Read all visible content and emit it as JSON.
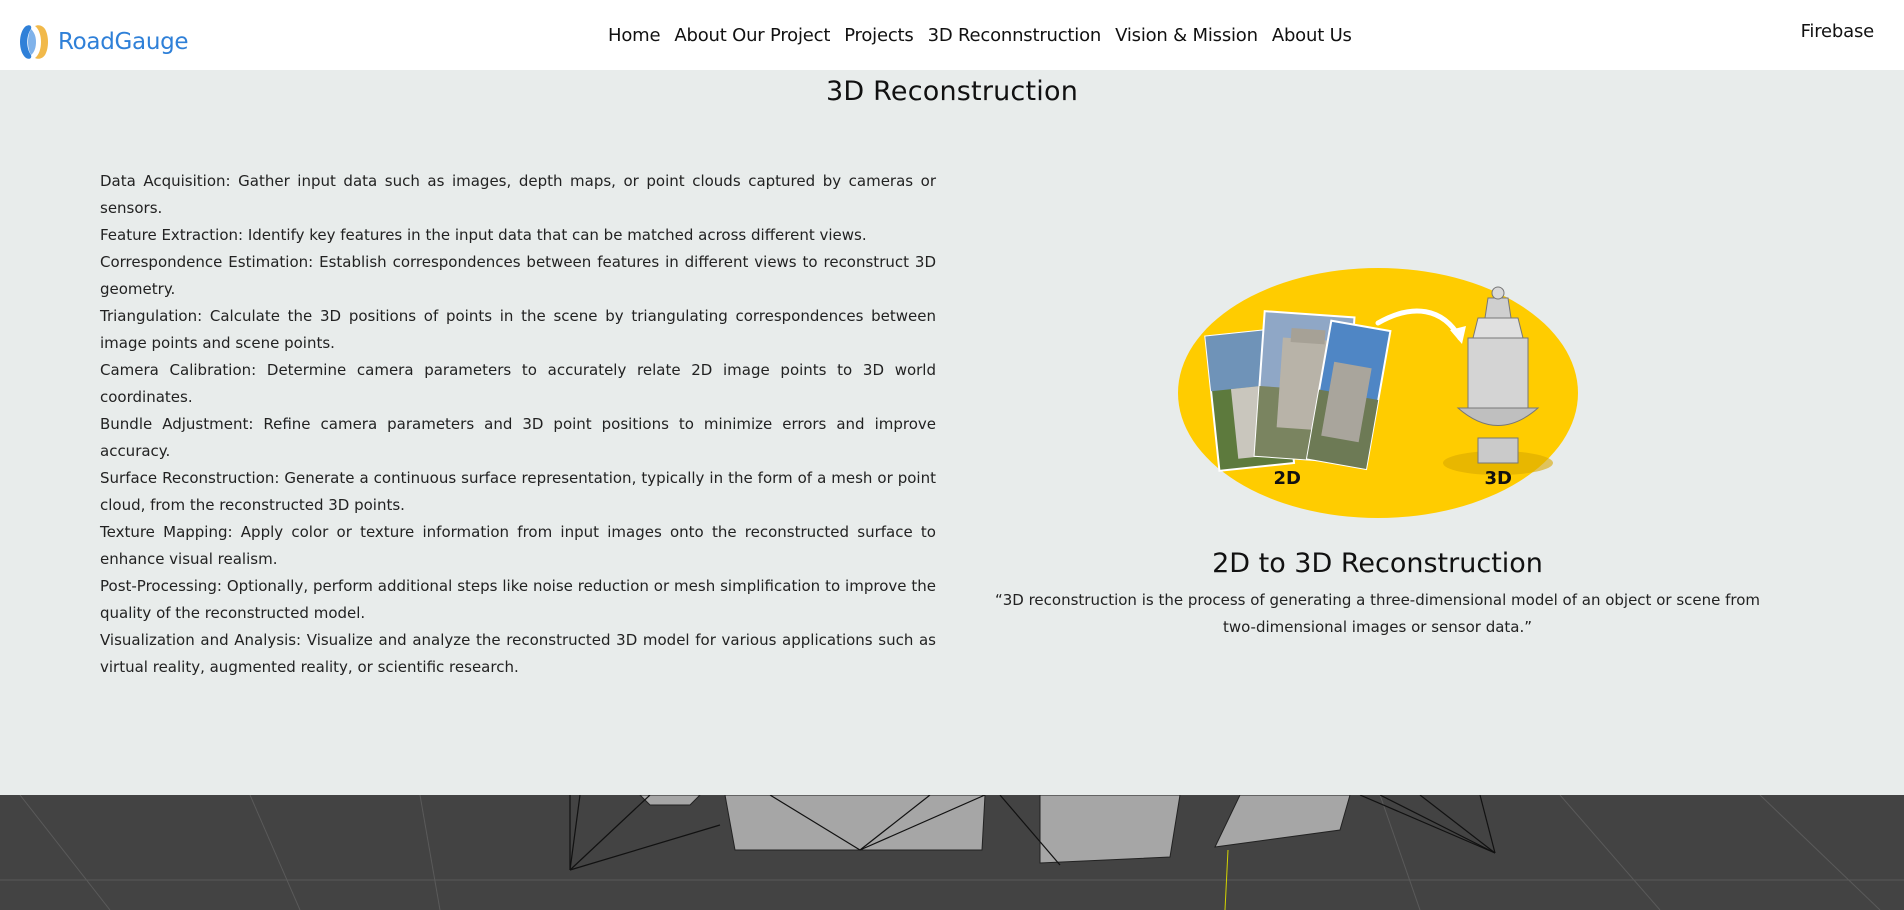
{
  "header": {
    "brand": "RoadGauge",
    "nav": [
      {
        "label": "Home"
      },
      {
        "label": "About Our Project"
      },
      {
        "label": "Projects"
      },
      {
        "label": "3D Reconnstruction"
      },
      {
        "label": "Vision & Mission"
      },
      {
        "label": "About Us"
      }
    ],
    "right_link": "Firebase"
  },
  "main": {
    "title": "3D Reconstruction",
    "steps": [
      "Data Acquisition: Gather input data such as images, depth maps, or point clouds captured by cameras or sensors.",
      "Feature Extraction: Identify key features in the input data that can be matched across different views.",
      "Correspondence Estimation: Establish correspondences between features in different views to reconstruct 3D geometry.",
      "Triangulation: Calculate the 3D positions of points in the scene by triangulating correspondences between image points and scene points.",
      "Camera Calibration: Determine camera parameters to accurately relate 2D image points to 3D world coordinates.",
      "Bundle Adjustment: Refine camera parameters and 3D point positions to minimize errors and improve accuracy.",
      "Surface Reconstruction: Generate a continuous surface representation, typically in the form of a mesh or point cloud, from the reconstructed 3D points.",
      "Texture Mapping: Apply color or texture information from input images onto the reconstructed surface to enhance visual realism.",
      "Post-Processing: Optionally, perform additional steps like noise reduction or mesh simplification to improve the quality of the reconstructed model.",
      "Visualization and Analysis: Visualize and analyze the reconstructed 3D model for various applications such as virtual reality, augmented reality, or scientific research."
    ],
    "figure": {
      "label_2d": "2D",
      "label_3d": "3D"
    },
    "card_title": "2D to 3D Reconstruction",
    "card_quote": "“3D reconstruction is the process of generating a three-dimensional model of an object or scene from two-dimensional images or sensor data.”"
  },
  "colors": {
    "brand": "#2f80d8",
    "page_bg": "#e8eceb",
    "figure_yellow": "#ffcc00",
    "viewport_bg": "#434343"
  },
  "icons": {
    "logo": "roadgauge-logo-icon"
  }
}
